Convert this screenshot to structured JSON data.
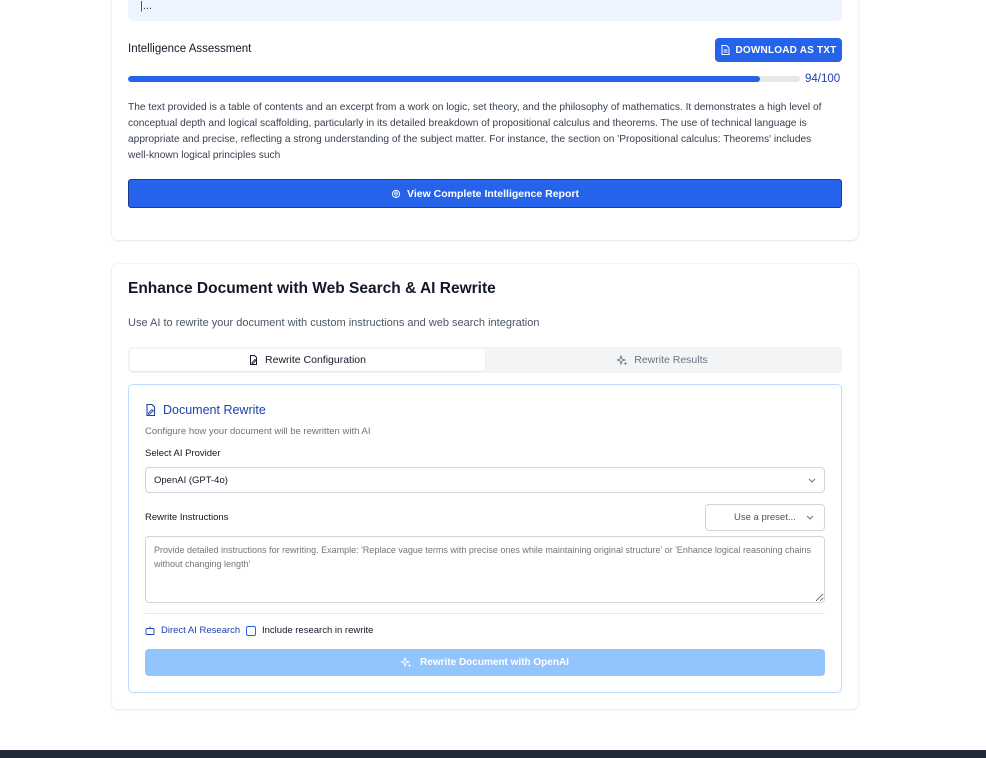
{
  "top_excerpt": {
    "text": "|..."
  },
  "intelligence": {
    "label": "Intelligence Assessment",
    "download_label": "DOWNLOAD AS TXT",
    "score_text": "94/100",
    "score_value": 94,
    "score_max": 100,
    "assessment": "The text provided is a table of contents and an excerpt from a work on logic, set theory, and the philosophy of mathematics. It demonstrates a high level of conceptual depth and logical scaffolding, particularly in its detailed breakdown of propositional calculus and theorems. The use of technical language is appropriate and precise, reflecting a strong understanding of the subject matter. For instance, the section on 'Propositional calculus: Theorems' includes well-known logical principles such",
    "report_button_label": "View Complete Intelligence Report"
  },
  "enhance": {
    "title": "Enhance Document with Web Search & AI Rewrite",
    "subtitle": "Use AI to rewrite your document with custom instructions and web search integration",
    "tabs": [
      {
        "label": "Rewrite Configuration",
        "active": true,
        "icon": "doc-edit-icon"
      },
      {
        "label": "Rewrite Results",
        "active": false,
        "icon": "sparkles-icon"
      }
    ],
    "panel": {
      "title": "Document Rewrite",
      "subtitle": "Configure how your document will be rewritten with AI",
      "provider_label": "Select AI Provider",
      "provider_value": "OpenAI (GPT-4o)",
      "instructions_label": "Rewrite Instructions",
      "preset_placeholder": "Use a preset...",
      "instructions_placeholder": "Provide detailed instructions for rewriting. Example: 'Replace vague terms with precise ones while maintaining original structure' or 'Enhance logical reasoning chains without changing length'",
      "research_link": "Direct AI Research",
      "include_research_label": "Include research in rewrite",
      "include_research_checked": false,
      "rewrite_button_label": "Rewrite Document with OpenAI"
    }
  },
  "colors": {
    "primary": "#2563eb",
    "primary_disabled": "#93c5fd",
    "panel_border": "#bfdbfe",
    "title_blue": "#1e40af"
  }
}
